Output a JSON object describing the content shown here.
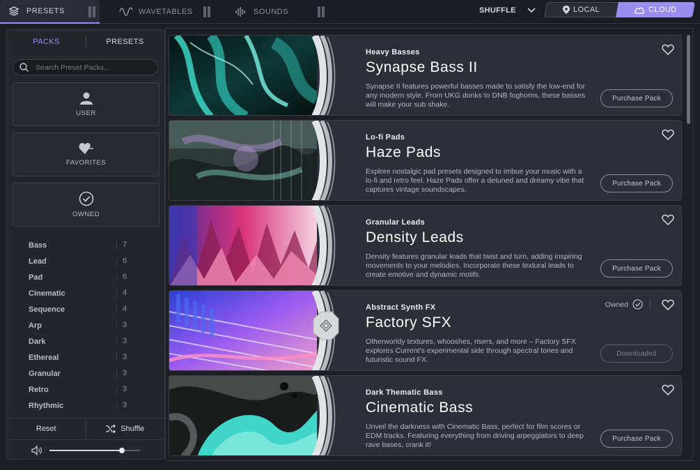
{
  "topbar": {
    "tabs": [
      {
        "label": "PRESETS",
        "icon": "layers-icon",
        "active": true
      },
      {
        "label": "WAVETABLES",
        "icon": "wave-icon",
        "active": false
      },
      {
        "label": "SOUNDS",
        "icon": "waveform-icon",
        "active": false
      }
    ],
    "shuffle_label": "SHUFFLE",
    "local_label": "LOCAL",
    "cloud_label": "CLOUD"
  },
  "sidebar": {
    "subtabs": [
      {
        "label": "PACKS",
        "active": true
      },
      {
        "label": "PRESETS",
        "active": false
      }
    ],
    "search_placeholder": "Search Preset Packs...",
    "big_buttons": [
      {
        "label": "USER",
        "icon": "user-icon"
      },
      {
        "label": "FAVORITES",
        "icon": "heart-icon"
      },
      {
        "label": "OWNED",
        "icon": "check-circle-icon"
      }
    ],
    "categories": [
      {
        "name": "Bass",
        "count": "7"
      },
      {
        "name": "Lead",
        "count": "6"
      },
      {
        "name": "Pad",
        "count": "6"
      },
      {
        "name": "Cinematic",
        "count": "4"
      },
      {
        "name": "Sequence",
        "count": "4"
      },
      {
        "name": "Arp",
        "count": "3"
      },
      {
        "name": "Dark",
        "count": "3"
      },
      {
        "name": "Ethereal",
        "count": "3"
      },
      {
        "name": "Granular",
        "count": "3"
      },
      {
        "name": "Retro",
        "count": "3"
      },
      {
        "name": "Rhythmic",
        "count": "3"
      }
    ],
    "reset_label": "Reset",
    "shuffle_label": "Shuffle",
    "volume": 0.8
  },
  "packs": [
    {
      "subtitle": "Heavy Basses",
      "title": "Synapse Bass II",
      "description": "Synapse II features powerful basses made to satisfy the low-end for any modern style. From UKG donks to DNB foghorns, these basses will make your sub shake.",
      "button": "Purchase Pack",
      "owned": false
    },
    {
      "subtitle": "Lo-fi Pads",
      "title": "Haze Pads",
      "description": "Explore nostalgic pad presets designed to imbue your music with a lo-fi and retro feel. Haze Pads offer a detuned and dreamy vibe that captures vintage soundscapes.",
      "button": "Purchase Pack",
      "owned": false
    },
    {
      "subtitle": "Granular Leads",
      "title": "Density Leads",
      "description": "Density features granular leads that twist and turn, adding inspiring movements to your melodies. Incorporate these textural leads to create emotive and dynamic motifs.",
      "button": "Purchase Pack",
      "owned": false
    },
    {
      "subtitle": "Abstract Synth FX",
      "title": "Factory SFX",
      "description": "Otherworldy textures, whooshes, risers, and more – Factory SFX explores Current's experimental side through spectral tones and futuristic sound FX.",
      "button": "Downloaded",
      "owned": true,
      "owned_label": "Owned"
    },
    {
      "subtitle": "Dark Thematic Bass",
      "title": "Cinematic Bass",
      "description": "Unveil the darkness with Cinematic Bass, perfect for film scores or EDM tracks. Featuring everything from driving arpeggiators to deep rave bases, crank it!",
      "button": "Purchase Pack",
      "owned": false
    }
  ]
}
